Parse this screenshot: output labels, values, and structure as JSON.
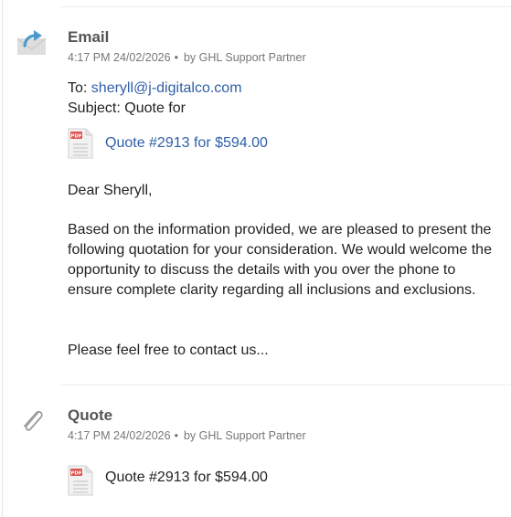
{
  "email": {
    "type_label": "Email",
    "timestamp": "4:17 PM 24/02/2026",
    "bullet": "•",
    "author": "by GHL Support Partner",
    "to_label": "To:",
    "to_address": "sheryll@j-digitalco.com",
    "subject_line": "Subject: Quote for",
    "attachment_label": "Quote #2913 for $594.00",
    "attachment_icon_text": "PDF",
    "greeting": "Dear Sheryll,",
    "body": "Based on the information provided, we are pleased to present the following quotation for your consideration. We would welcome the opportunity to discuss the details with you over the phone to ensure complete clarity regarding all inclusions and exclusions.",
    "closing": "Please feel free to contact us..."
  },
  "quote": {
    "type_label": "Quote",
    "timestamp": "4:17 PM 24/02/2026",
    "bullet": "•",
    "author": "by GHL Support Partner",
    "attachment_label": "Quote #2913 for $594.00",
    "attachment_icon_text": "PDF"
  },
  "icons": {
    "email": "envelope-forward-icon",
    "quote": "paperclip-icon",
    "attachment": "pdf-file-icon"
  },
  "colors": {
    "link": "#2f5fa7",
    "pdf_badge": "#d9534f",
    "arrow": "#4a9bc9"
  }
}
